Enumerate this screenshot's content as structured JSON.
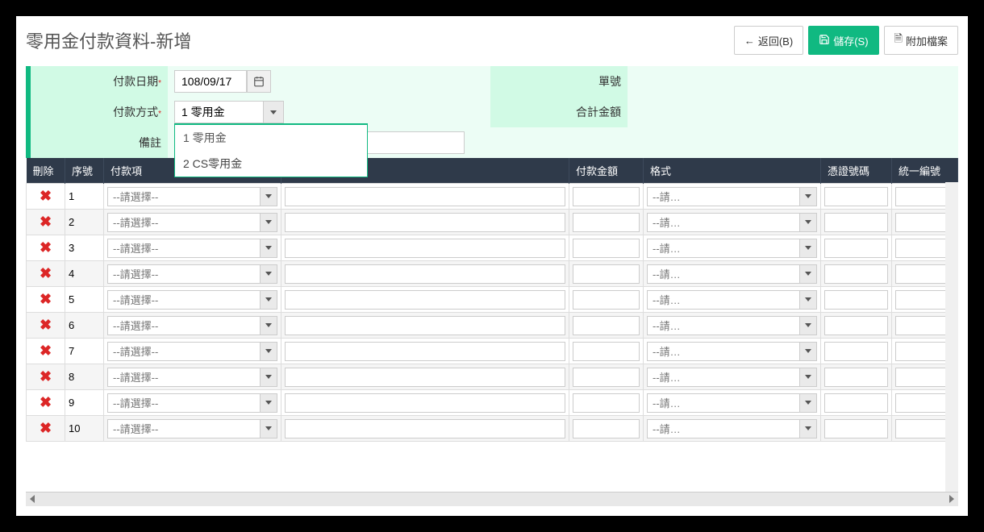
{
  "page_title": "零用金付款資料-新增",
  "header": {
    "back_label": "返回(B)",
    "save_label": "儲存(S)",
    "attach_label": "附加檔案"
  },
  "form": {
    "payment_date_label": "付款日期",
    "payment_date_value": "108/09/17",
    "doc_no_label": "單號",
    "doc_no_value": "",
    "payment_method_label": "付款方式",
    "payment_method_value": "1 零用金",
    "payment_method_options": [
      "1 零用金",
      "2 CS零用金"
    ],
    "total_amount_label": "合計金額",
    "total_amount_value": "",
    "remark_label": "備註",
    "remark_value": ""
  },
  "grid": {
    "columns": {
      "delete": "刪除",
      "seq": "序號",
      "item": "付款項",
      "desc": "",
      "amount": "付款金額",
      "format": "格式",
      "voucher": "憑證號碼",
      "unino": "統一編號"
    },
    "item_placeholder": "--請選擇--",
    "format_placeholder": "--請…",
    "rows": [
      {
        "seq": "1"
      },
      {
        "seq": "2"
      },
      {
        "seq": "3"
      },
      {
        "seq": "4"
      },
      {
        "seq": "5"
      },
      {
        "seq": "6"
      },
      {
        "seq": "7"
      },
      {
        "seq": "8"
      },
      {
        "seq": "9"
      },
      {
        "seq": "10"
      }
    ]
  }
}
